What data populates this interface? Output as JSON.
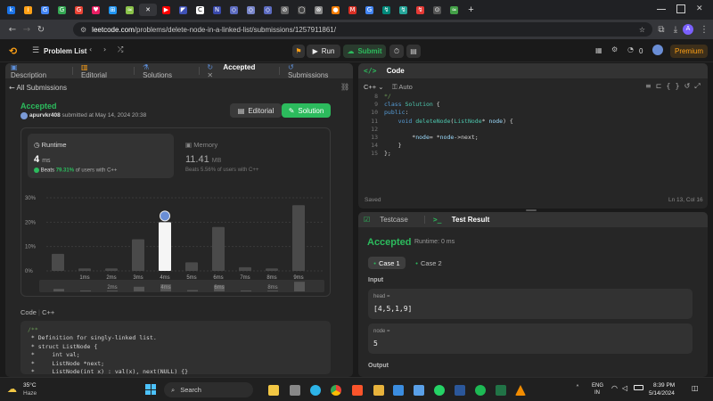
{
  "browser": {
    "tab_glyphs": [
      "k",
      "i",
      "G",
      "G",
      "G",
      "♥",
      "⊞",
      "≈",
      "✕",
      "▶",
      "◤",
      "C",
      "N",
      "◇",
      "◇",
      "◇",
      "⊘",
      "◯",
      "⊗",
      "●",
      "M",
      "G",
      "↯",
      "↯",
      "↯",
      "⊙",
      "≈"
    ],
    "close_glyph": "✕",
    "new_tab": "+",
    "url_host": "leetcode.com",
    "url_path": "/problems/delete-node-in-a-linked-list/submissions/1257911861/",
    "avatar_letter": "A"
  },
  "topbar": {
    "problem_list": "Problem List",
    "run": "Run",
    "submit": "Submit",
    "coins": "0",
    "premium": "Premium"
  },
  "left_tabs": {
    "description": "Description",
    "editorial": "Editorial",
    "solutions": "Solutions",
    "accepted": "Accepted",
    "submissions": "Submissions"
  },
  "submission": {
    "back": "All Submissions",
    "status": "Accepted",
    "user": "apurvkr408",
    "submitted_text": "submitted at May 14, 2024 20:38",
    "editorial_btn": "Editorial",
    "solution_btn": "Solution",
    "runtime_label": "Runtime",
    "runtime_value": "4",
    "runtime_unit": "ms",
    "runtime_beats_label": "Beats",
    "runtime_beats_pct": "79.31%",
    "runtime_beats_tail": "of users with C++",
    "memory_label": "Memory",
    "memory_value": "11.41",
    "memory_unit": "MB",
    "memory_beats_label": "Beats",
    "memory_beats_pct": "5.56%",
    "memory_beats_tail": "of users with C++",
    "code_label": "Code",
    "lang_label": "C++"
  },
  "chart_data": {
    "type": "bar",
    "categories": [
      "",
      "1ms",
      "2ms",
      "3ms",
      "4ms",
      "5ms",
      "6ms",
      "7ms",
      "8ms",
      "9ms"
    ],
    "values": [
      7,
      1,
      1,
      13,
      20,
      3.5,
      18,
      1.5,
      1,
      27
    ],
    "highlight_index": 4,
    "yticks": [
      "30%",
      "20%",
      "10%",
      "0%"
    ],
    "ylim": [
      0,
      30
    ],
    "mini_labels": [
      "2ms",
      "4ms",
      "6ms",
      "8ms"
    ]
  },
  "code_preview": [
    "/**",
    " * Definition for singly-linked list.",
    " * struct ListNode {",
    " *     int val;",
    " *     ListNode *next;",
    " *     ListNode(int x) : val(x), next(NULL) {}"
  ],
  "editor": {
    "title": "Code",
    "lang": "C++",
    "mode": "Auto",
    "saved": "Saved",
    "cursor": "Ln 13, Col 16",
    "line_numbers": [
      "8",
      "9",
      "10",
      "11",
      "12",
      "13",
      "14",
      "15"
    ],
    "lines": [
      "*/",
      "class Solution {",
      "public:",
      "    void deleteNode(ListNode* node) {",
      "",
      "        *node= *node->next;",
      "    }",
      "};"
    ]
  },
  "result": {
    "testcase_tab": "Testcase",
    "result_tab": "Test Result",
    "status": "Accepted",
    "runtime": "Runtime: 0 ms",
    "case1": "Case 1",
    "case2": "Case 2",
    "input_label": "Input",
    "head_label": "head =",
    "head_value": "[4,5,1,9]",
    "node_label": "node =",
    "node_value": "5",
    "output_label": "Output"
  },
  "taskbar": {
    "temp": "35°C",
    "weather": "Haze",
    "search": "Search",
    "lang_top": "ENG",
    "lang_bot": "IN",
    "time": "8:39 PM",
    "date": "5/14/2024",
    "colors": {
      "chrome": "#fbbc05",
      "brave": "#fb542b",
      "accent": "#2cbb5d",
      "premium": "#ffa116"
    }
  }
}
